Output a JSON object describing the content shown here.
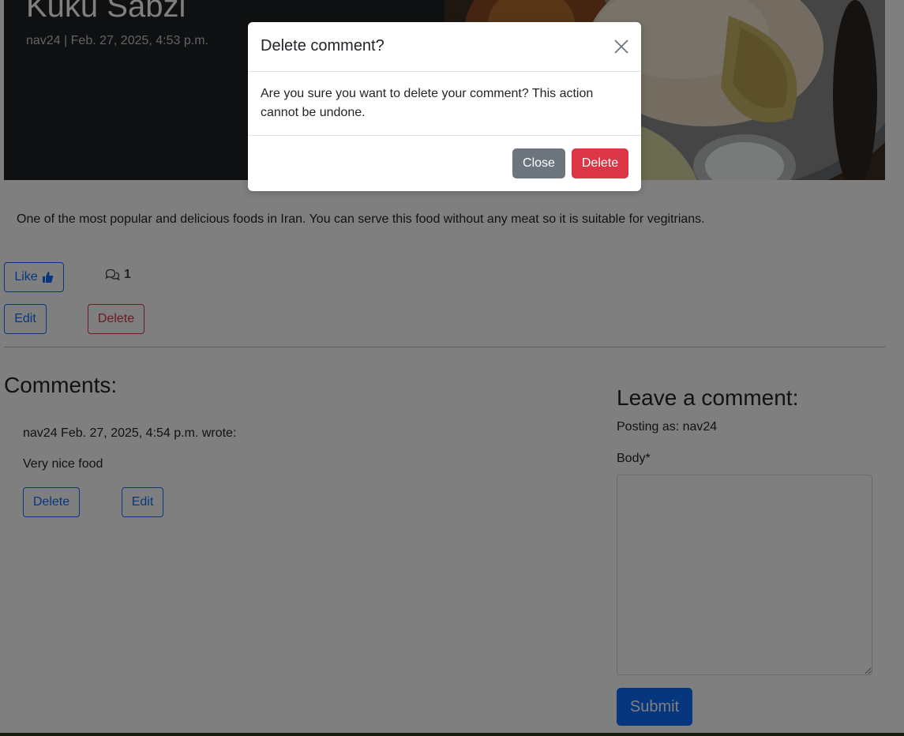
{
  "post": {
    "title": "Kuku Sabzi",
    "meta": "nav24 | Feb. 27, 2025, 4:53 p.m.",
    "excerpt": "One of the most popular and delicious foods in Iran. You can serve this food without any meat so it is suitable for vegitrians.",
    "like_label": "Like",
    "comment_count": "1",
    "edit_label": "Edit",
    "delete_label": "Delete"
  },
  "comments": {
    "title": "Comments:",
    "items": [
      {
        "header": "nav24 Feb. 27, 2025, 4:54 p.m. wrote:",
        "body": "Very nice food",
        "delete_label": "Delete",
        "edit_label": "Edit"
      }
    ]
  },
  "comment_form": {
    "title": "Leave a comment:",
    "posting_as": "Posting as: nav24",
    "body_label": "Body*",
    "body_value": "",
    "submit_label": "Submit"
  },
  "modal": {
    "title": "Delete comment?",
    "message": "Are you sure you want to delete your comment? This action cannot be undone.",
    "close_label": "Close",
    "delete_label": "Delete"
  },
  "colors": {
    "primary": "#0d6efd",
    "danger": "#dc3545",
    "secondary": "#6c757d"
  }
}
